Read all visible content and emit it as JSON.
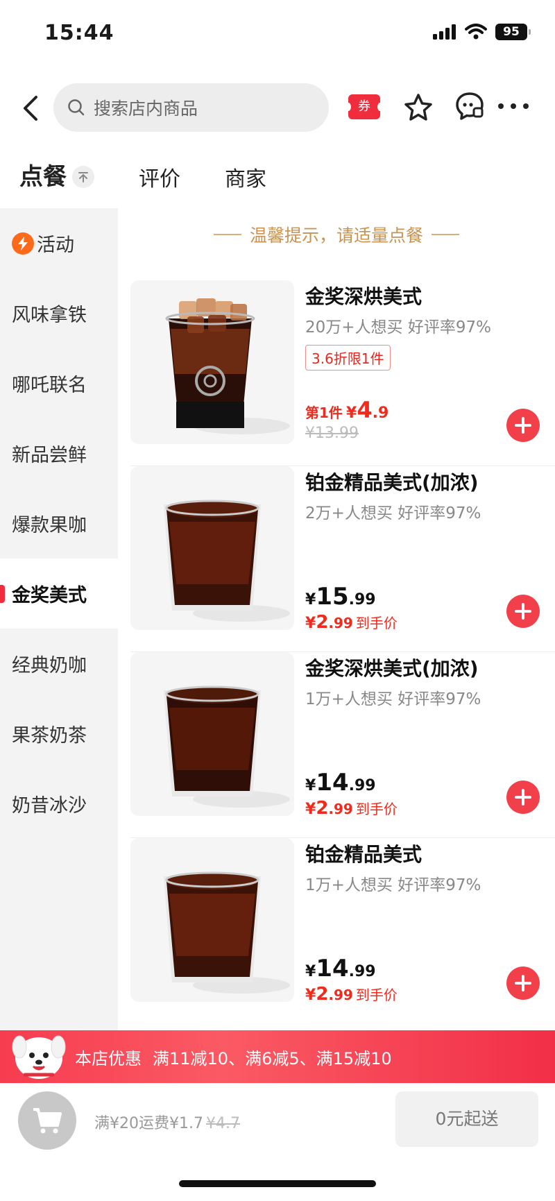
{
  "status_bar": {
    "time": "15:44",
    "battery": "95"
  },
  "search": {
    "placeholder": "搜索店内商品"
  },
  "nav": {
    "coupon_label": "券"
  },
  "tabs": [
    {
      "label": "点餐",
      "active": true
    },
    {
      "label": "评价",
      "active": false
    },
    {
      "label": "商家",
      "active": false
    }
  ],
  "sidebar": {
    "items": [
      {
        "label": "活动"
      },
      {
        "label": "风味拿铁"
      },
      {
        "label": "哪吒联名"
      },
      {
        "label": "新品尝鲜"
      },
      {
        "label": "爆款果咖"
      },
      {
        "label": "金奖美式"
      },
      {
        "label": "经典奶咖"
      },
      {
        "label": "果茶奶茶"
      },
      {
        "label": "奶昔冰沙"
      }
    ],
    "active_index": 5
  },
  "tip": "温馨提示，请适量点餐",
  "products": [
    {
      "name": "金奖深烘美式",
      "meta": "20万+人想买  好评率97%",
      "promo_tag": "3.6折限1件",
      "first_label": "第1件",
      "currency": "¥",
      "first_price_int": "4",
      "first_price_dec": ".9",
      "original_price": "¥13.99"
    },
    {
      "name": "铂金精品美式(加浓)",
      "meta": "2万+人想买  好评率97%",
      "currency": "¥",
      "price_int": "15",
      "price_dec": ".99",
      "final_int": "2",
      "final_dec": ".99",
      "final_suffix": "到手价"
    },
    {
      "name": "金奖深烘美式(加浓)",
      "meta": "1万+人想买  好评率97%",
      "currency": "¥",
      "price_int": "14",
      "price_dec": ".99",
      "final_int": "2",
      "final_dec": ".99",
      "final_suffix": "到手价"
    },
    {
      "name": "铂金精品美式",
      "meta": "1万+人想买  好评率97%",
      "currency": "¥",
      "price_int": "14",
      "price_dec": ".99",
      "final_int": "2",
      "final_dec": ".99",
      "final_suffix": "到手价"
    }
  ],
  "promo_banner": {
    "label": "本店优惠",
    "offers": "满11减10、满6减5、满15减10"
  },
  "cart": {
    "delivery_text": "满¥20运费¥1.7",
    "delivery_original": "¥4.7",
    "min_order_label": "0元起送"
  },
  "colors": {
    "accent": "#ef2d3d",
    "tip": "#c89350",
    "sidebar_bg": "#f3f3f3"
  }
}
